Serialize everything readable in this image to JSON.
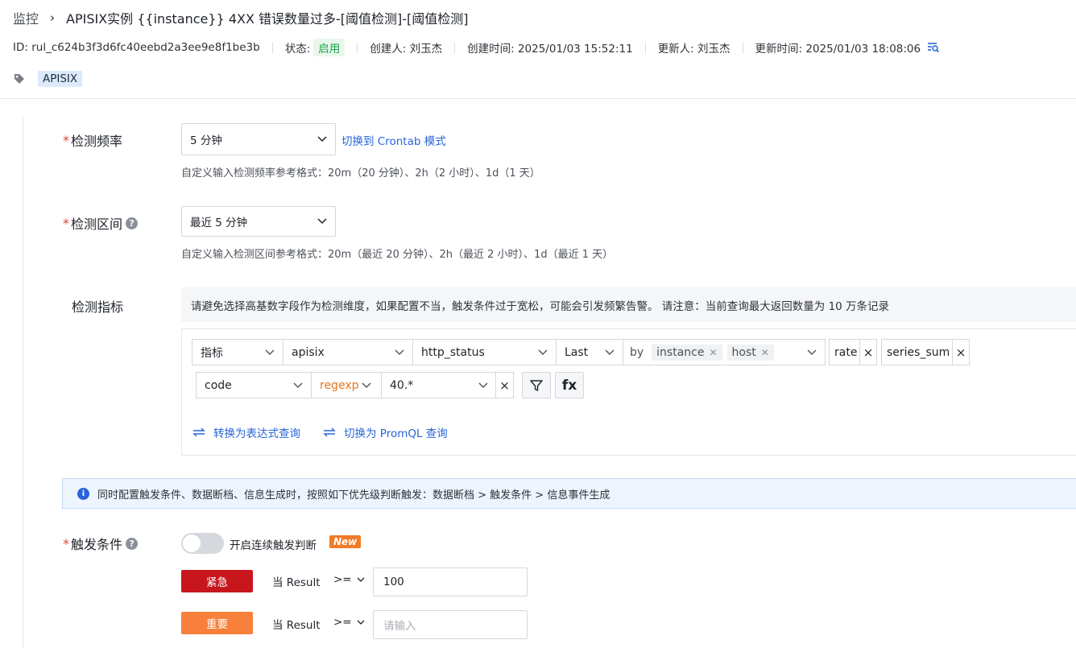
{
  "header": {
    "breadcrumb": "监控",
    "title": "APISIX实例 {{instance}} 4XX 错误数量过多-[阈值检测]-[阈值检测]"
  },
  "meta": {
    "id": "ID: rul_c624b3f3d6fc40eebd2a3ee9e8f1be3b",
    "status_label": "状态:",
    "status_value": "启用",
    "creator": "创建人: 刘玉杰",
    "created_at": "创建时间: 2025/01/03 15:52:11",
    "updater": "更新人: 刘玉杰",
    "updated_at": "更新时间: 2025/01/03 18:08:06"
  },
  "tags": [
    "APISIX"
  ],
  "frequency": {
    "label": "检测频率",
    "value": "5 分钟",
    "switch_link": "切换到 Crontab 模式",
    "hint": "自定义输入检测频率参考格式：20m（20 分钟）、2h（2 小时）、1d（1 天）"
  },
  "interval": {
    "label": "检测区间",
    "value": "最近 5 分钟",
    "hint": "自定义输入检测区间参考格式：20m（最近 20 分钟）、2h（最近 2 小时）、1d（最近 1 天）"
  },
  "metrics": {
    "label": "检测指标",
    "warning": "请避免选择高基数字段作为检测维度，如果配置不当，触发条件过于宽松，可能会引发频繁告警。 请注意：当前查询最大返回数量为 10 万条记录",
    "type": "指标",
    "source": "apisix",
    "field": "http_status",
    "aggregation": "Last",
    "by_label": "by",
    "by_chips": [
      "instance",
      "host"
    ],
    "func1": "rate",
    "func2": "series_sum",
    "filter_key": "code",
    "filter_op": "regexp",
    "filter_value": "40.*",
    "fx_label": "fx",
    "link_expression": "转换为表达式查询",
    "link_promql": "切换为 PromQL 查询"
  },
  "info": "同时配置触发条件、数据断档、信息生成时，按照如下优先级判断触发：数据断档 > 触发条件 > 信息事件生成",
  "trigger": {
    "label": "触发条件",
    "toggle_label": "开启连续触发判断",
    "new_badge": "New",
    "rows": [
      {
        "level": "紧急",
        "color": "#c8161d",
        "cond": "当 Result",
        "op": ">=",
        "value": "100",
        "placeholder": ""
      },
      {
        "level": "重要",
        "color": "#f7813a",
        "cond": "当 Result",
        "op": ">=",
        "value": "",
        "placeholder": "请输入"
      }
    ]
  }
}
